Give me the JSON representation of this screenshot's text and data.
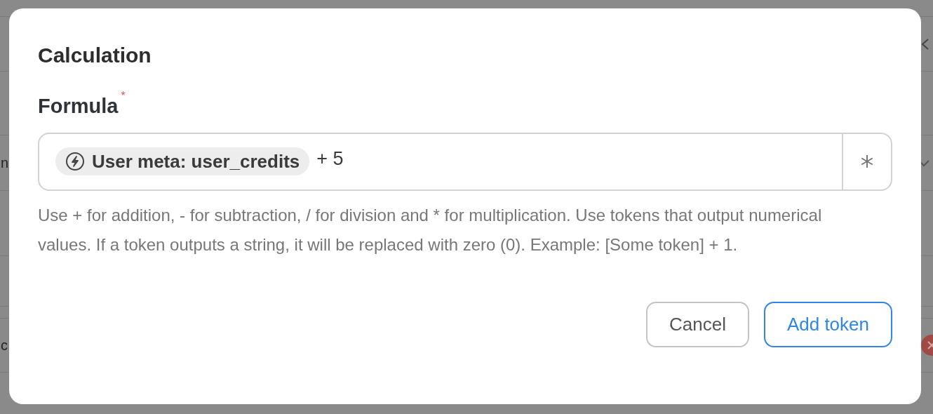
{
  "background": {
    "row_texts": [
      "n",
      "c"
    ]
  },
  "dialog": {
    "title": "Calculation",
    "field_label": "Formula",
    "required_mark": "*",
    "formula": [
      {
        "kind": "token",
        "text": "User meta: user_credits"
      },
      {
        "kind": "text",
        "text": "+ 5"
      }
    ],
    "help": "Use + for addition, - for subtraction, / for division and * for multiplication. Use tokens that output numerical values. If a token outputs a string, it will be replaced with zero (0). Example: [Some token] + 1.",
    "buttons": [
      {
        "label": "Cancel",
        "primary": false
      },
      {
        "label": "Add token",
        "primary": true
      }
    ]
  }
}
